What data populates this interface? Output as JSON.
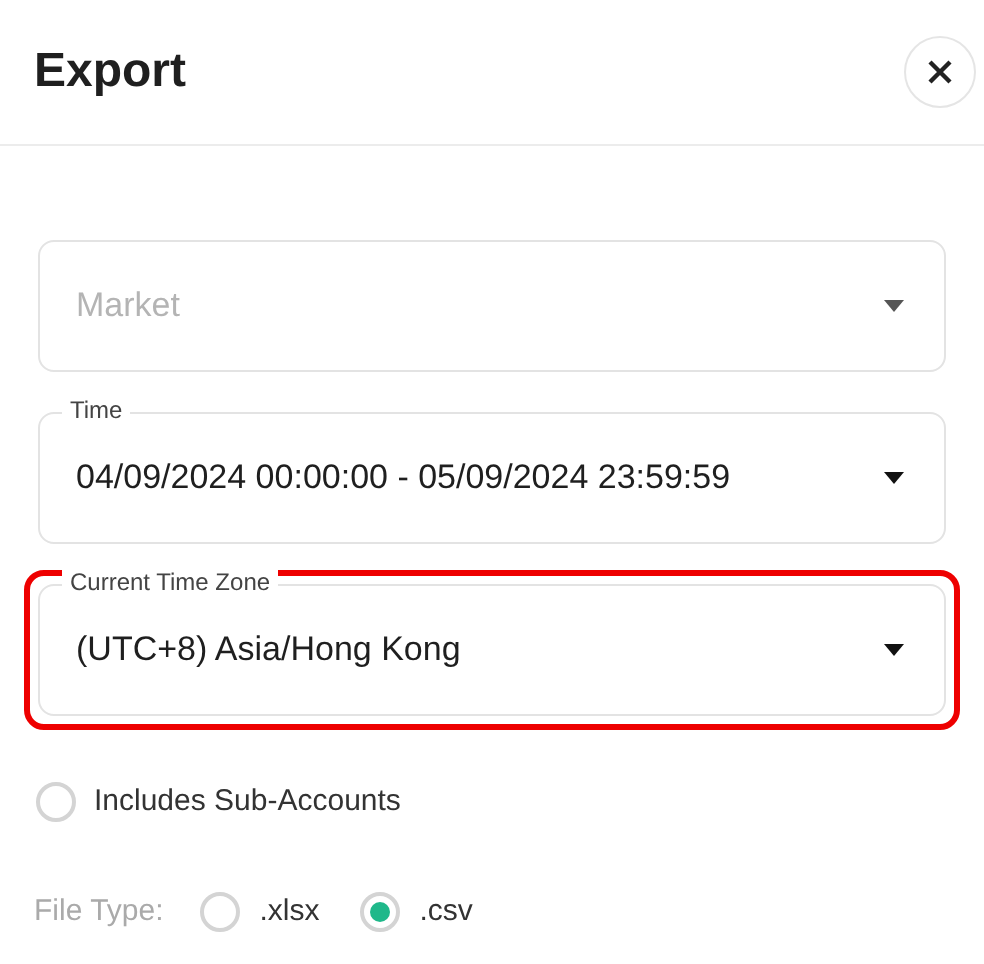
{
  "title": "Export",
  "fields": [
    {
      "placeholder": "Market",
      "highlighted": false
    },
    {
      "label": "Time",
      "value": "04/09/2024 00:00:00 - 05/09/2024 23:59:59",
      "highlighted": false
    },
    {
      "label": "Current Time Zone",
      "value": "(UTC+8) Asia/Hong Kong",
      "highlighted": true
    }
  ],
  "sub_accounts": {
    "label": "Includes Sub-Accounts",
    "checked": false
  },
  "file_type": {
    "label": "File Type:",
    "options": [
      {
        "label": ".xlsx",
        "selected": false
      },
      {
        "label": ".csv",
        "selected": true
      }
    ]
  }
}
